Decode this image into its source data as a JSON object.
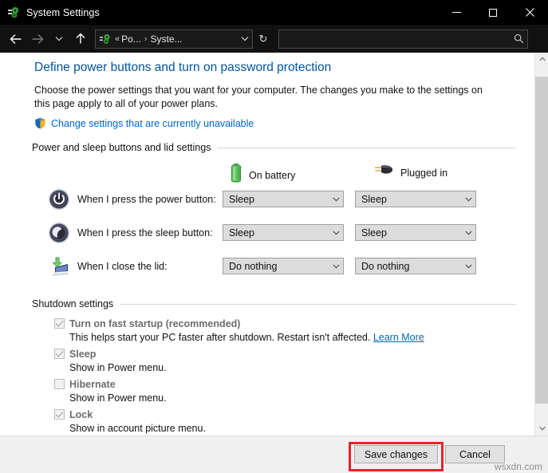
{
  "window": {
    "title": "System Settings",
    "icon": "system-settings-icon",
    "controls": {
      "minimize": "—",
      "maximize": "□",
      "close": "✕"
    }
  },
  "navbar": {
    "back": "back-arrow-icon",
    "forward": "forward-arrow-icon",
    "recent": "chevron-down-icon",
    "up": "up-arrow-icon",
    "breadcrumb": {
      "overflow": "«",
      "items": [
        "Po...",
        "Syste..."
      ],
      "separator": "›",
      "dropdown": "ˇ"
    },
    "refresh": "↻",
    "search": {
      "value": "",
      "placeholder": "",
      "icon": "search-icon"
    }
  },
  "page": {
    "title": "Define power buttons and turn on password protection",
    "description": "Choose the power settings that you want for your computer. The changes you make to the settings on this page apply to all of your power plans.",
    "uac_link": "Change settings that are currently unavailable",
    "uac_icon": "uac-shield-icon"
  },
  "power_section": {
    "heading": "Power and sleep buttons and lid settings",
    "columns": [
      {
        "label": "On battery",
        "icon": "battery-icon"
      },
      {
        "label": "Plugged in",
        "icon": "power-plug-icon"
      }
    ],
    "rows": [
      {
        "icon": "power-button-icon",
        "label": "When I press the power button:",
        "on_battery": "Sleep",
        "plugged_in": "Sleep"
      },
      {
        "icon": "sleep-moon-icon",
        "label": "When I press the sleep button:",
        "on_battery": "Sleep",
        "plugged_in": "Sleep"
      },
      {
        "icon": "close-lid-icon",
        "label": "When I close the lid:",
        "on_battery": "Do nothing",
        "plugged_in": "Do nothing"
      }
    ]
  },
  "shutdown_section": {
    "heading": "Shutdown settings",
    "items": [
      {
        "label": "Turn on fast startup (recommended)",
        "checked": true,
        "disabled": true,
        "description": "This helps start your PC faster after shutdown. Restart isn't affected.",
        "link": "Learn More"
      },
      {
        "label": "Sleep",
        "checked": true,
        "disabled": true,
        "description": "Show in Power menu.",
        "link": ""
      },
      {
        "label": "Hibernate",
        "checked": false,
        "disabled": true,
        "description": "Show in Power menu.",
        "link": ""
      },
      {
        "label": "Lock",
        "checked": true,
        "disabled": true,
        "description": "Show in account picture menu.",
        "link": ""
      }
    ]
  },
  "footer": {
    "save_label": "Save changes",
    "cancel_label": "Cancel",
    "highlight_color": "#e8232a",
    "watermark": "wsxdn.com"
  },
  "scrollbar": {
    "up": "˄",
    "down": "˅"
  }
}
